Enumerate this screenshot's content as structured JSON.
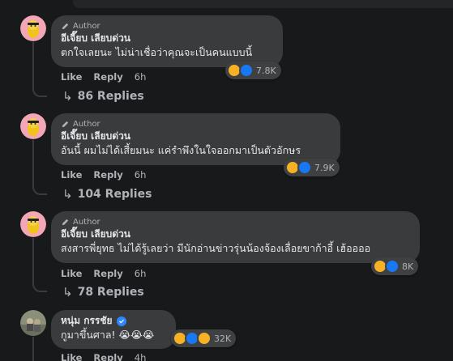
{
  "comments": [
    {
      "author_badge": "Author",
      "name": "อีเจี๊ยบ เลียบด่วน",
      "text": "ตกใจเลยนะ ไม่น่าเชื่อว่าคุณจะเป็นคนแบบนี้",
      "reaction_count": "7.8K",
      "actions": {
        "like": "Like",
        "reply": "Reply",
        "time": "6h"
      },
      "replies": "86 Replies"
    },
    {
      "author_badge": "Author",
      "name": "อีเจี๊ยบ เลียบด่วน",
      "text": "อันนี้ ผมไม่ได้เสี้ยมนะ แค่รำพึงในใจออกมาเป็นตัวอักษร",
      "reaction_count": "7.9K",
      "actions": {
        "like": "Like",
        "reply": "Reply",
        "time": "6h"
      },
      "replies": "104 Replies"
    },
    {
      "author_badge": "Author",
      "name": "อีเจี๊ยบ เลียบด่วน",
      "text": "สงสารพี่ยุทธ ไม่ได้รู้เลยว่า มีนักอ่านข่าวรุ่นน้องจ้องเลื่อยขาก้าอี้ เฮ้ออออ",
      "reaction_count": "8K",
      "actions": {
        "like": "Like",
        "reply": "Reply",
        "time": "6h"
      },
      "replies": "78 Replies"
    },
    {
      "name": "หนุ่ม กรรชัย",
      "text": "กูมาขึ้นศาล! 😭😭😭",
      "reaction_count": "32K",
      "actions": {
        "like": "Like",
        "reply": "Reply",
        "time": "4h"
      }
    }
  ],
  "colors": {
    "background": "#18191a",
    "bubble": "#3a3b3c",
    "secondary_text": "#b0b3b8",
    "like_blue": "#1877f2",
    "haha_yellow": "#f7b125"
  }
}
